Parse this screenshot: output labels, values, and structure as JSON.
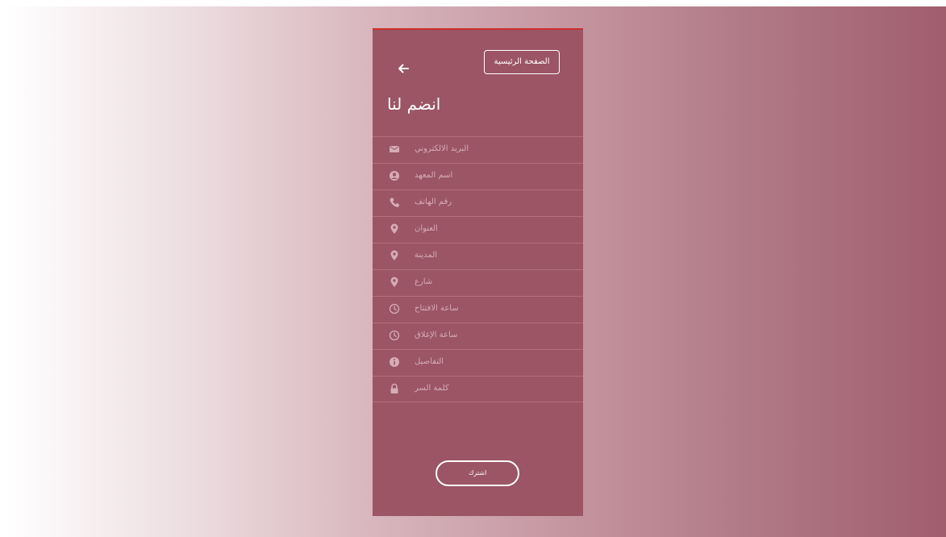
{
  "header": {
    "home_label": "الصفحة الرئيسية",
    "title": "انضم لنا"
  },
  "form": {
    "fields": [
      {
        "placeholder": "البريد الالكتروني",
        "icon": "envelope-icon"
      },
      {
        "placeholder": "اسم المعهد",
        "icon": "user-circle-icon"
      },
      {
        "placeholder": "رقم الهاتف",
        "icon": "phone-icon"
      },
      {
        "placeholder": "العنوان",
        "icon": "map-marker-icon"
      },
      {
        "placeholder": "المدينة",
        "icon": "map-marker-icon"
      },
      {
        "placeholder": "شارع",
        "icon": "map-marker-icon"
      },
      {
        "placeholder": "ساعة الافتتاح",
        "icon": "clock-icon"
      },
      {
        "placeholder": "ساعة الإغلاق",
        "icon": "clock-icon"
      },
      {
        "placeholder": "التفاصيل",
        "icon": "info-circle-icon"
      },
      {
        "placeholder": "كلمة السر",
        "icon": "lock-icon"
      }
    ],
    "submit_label": "اشترك"
  },
  "colors": {
    "panel": "#9b5564",
    "accent_top": "#c9302c",
    "icon": "#d6adb6"
  }
}
